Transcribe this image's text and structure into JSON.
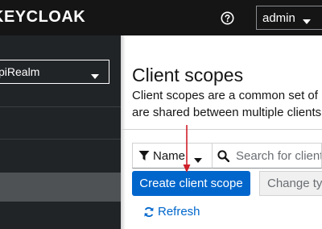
{
  "header": {
    "logo_text": "KEYCLOAK",
    "help_icon": "question-circle-icon",
    "user_menu_label": "admin"
  },
  "sidebar": {
    "realm_selector_label": "piRealm"
  },
  "main": {
    "title": "Client scopes",
    "description_line1": "Client scopes are a common set of pro",
    "description_line2": "are shared between multiple clients."
  },
  "toolbar": {
    "filter_label": "Name",
    "search_placeholder": "Search for client s",
    "create_button_label": "Create client scope",
    "type_select_label": "Change typ",
    "refresh_label": "Refresh"
  },
  "colors": {
    "header_bg": "#151515",
    "sidebar_bg": "#212427",
    "sidebar_active_bg": "#4f5255",
    "primary": "#0066cc",
    "annotation_arrow": "#d0202a"
  }
}
